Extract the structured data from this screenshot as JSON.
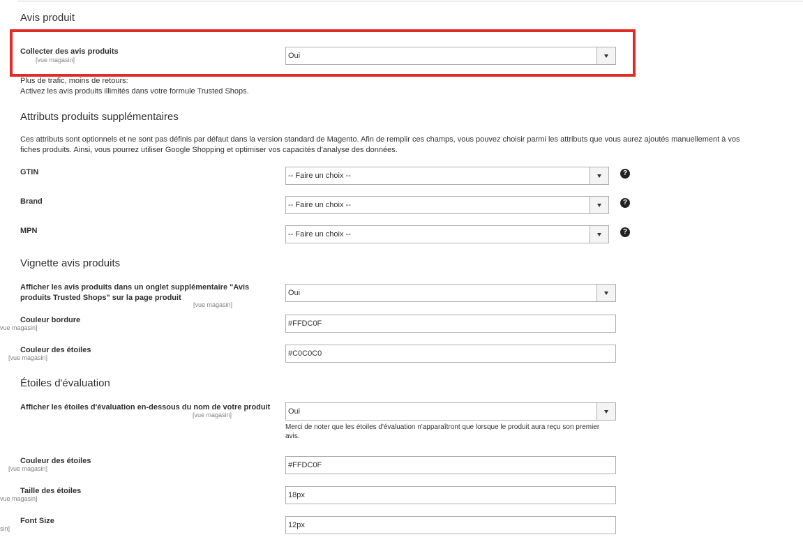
{
  "colors": {
    "highlight": "#e02b27"
  },
  "avis_produit": {
    "title": "Avis produit",
    "collect_label": "Collecter des avis produits",
    "collect_scope": "[vue magasin]",
    "collect_value": "Oui",
    "note_line1": "Plus de trafic, moins de retours:",
    "note_line2": "Activez les avis produits illimités dans votre formule Trusted Shops."
  },
  "attributs": {
    "title": "Attributs produits supplémentaires",
    "description_line1": "Ces attributs sont optionnels et ne sont pas définis par défaut dans la version standard de Magento. Afin de remplir ces champs, vous pouvez choisir parmi les attributs que vous aurez ajoutés manuellement à vos",
    "description_line2": "fiches produits. Ainsi, vous pourrez utiliser Google Shopping et optimiser vos capacités d'analyse des données.",
    "gtin_label": "GTIN",
    "gtin_value": "-- Faire un choix --",
    "brand_label": "Brand",
    "brand_value": "-- Faire un choix --",
    "mpn_label": "MPN",
    "mpn_value": "-- Faire un choix --",
    "help_glyph": "?"
  },
  "vignette": {
    "title": "Vignette avis produits",
    "tab_label": "Afficher les avis produits dans un onglet supplémentaire \"Avis produits Trusted Shops\" sur la page produit",
    "tab_scope": "[vue magasin]",
    "tab_value": "Oui",
    "border_label": "Couleur bordure",
    "border_scope": "vue magasin]",
    "border_value": "#FFDC0F",
    "stars_label": "Couleur des étoiles",
    "stars_scope": "[vue magasin]",
    "stars_value": "#C0C0C0"
  },
  "etoiles": {
    "title": "Étoiles d'évaluation",
    "show_label": "Afficher les étoiles d'évaluation en-dessous du nom de votre produit",
    "show_scope": "[vue magasin]",
    "show_value": "Oui",
    "show_note_line1": "Merci de noter que les étoiles d'évaluation n'apparaîtront que lorsque le produit aura reçu son premier",
    "show_note_line2": "avis.",
    "color_label": "Couleur des étoiles",
    "color_scope": "[vue magasin]",
    "color_value": "#FFDC0F",
    "size_label": "Taille des étoiles",
    "size_scope": "vue magasin]",
    "size_value": "18px",
    "font_label": "Font Size",
    "font_scope": "sin]",
    "font_value": "12px"
  }
}
